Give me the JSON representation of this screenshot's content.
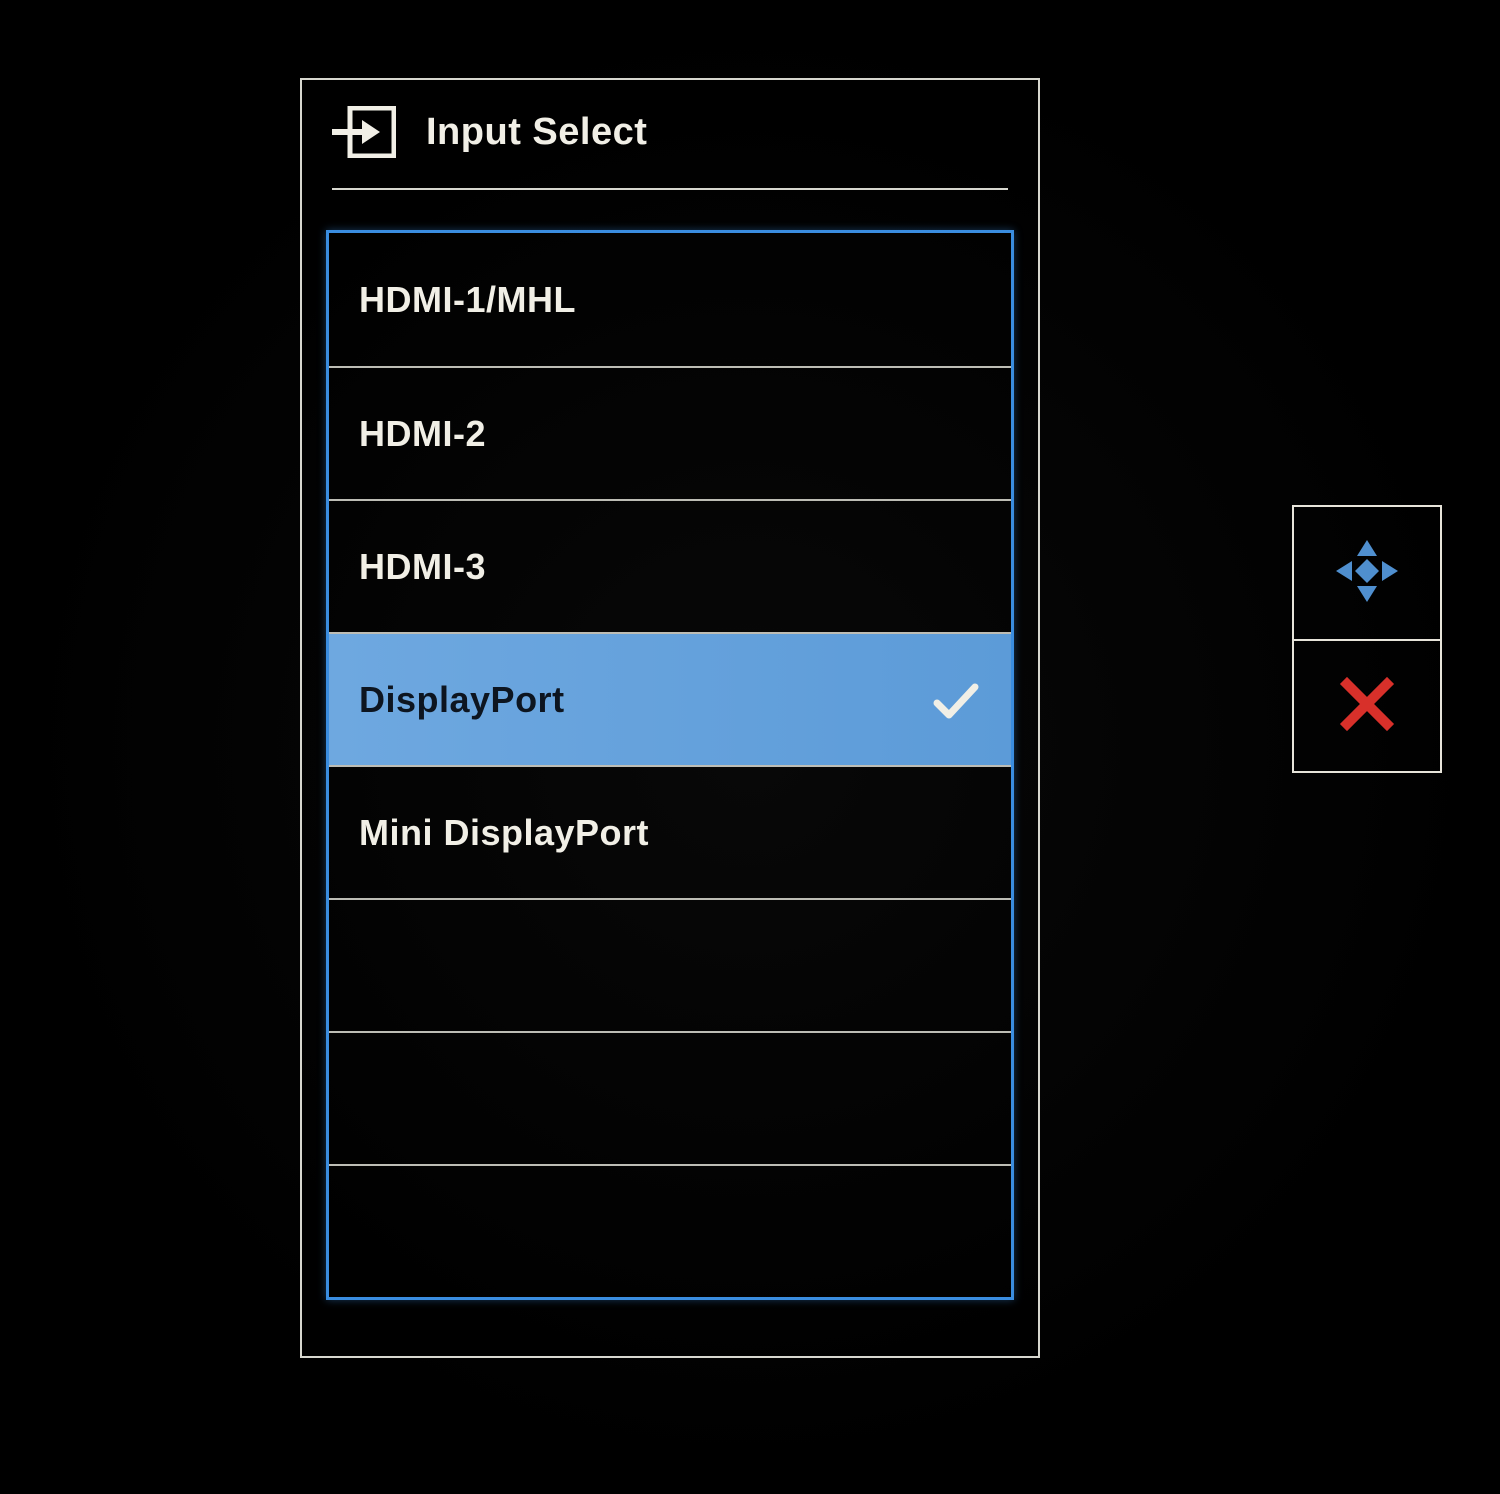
{
  "menu": {
    "title": "Input Select",
    "items": [
      {
        "label": "HDMI-1/MHL",
        "selected": false
      },
      {
        "label": "HDMI-2",
        "selected": false
      },
      {
        "label": "HDMI-3",
        "selected": false
      },
      {
        "label": "DisplayPort",
        "selected": true
      },
      {
        "label": "Mini DisplayPort",
        "selected": false
      },
      {
        "label": "",
        "selected": false
      },
      {
        "label": "",
        "selected": false
      },
      {
        "label": "",
        "selected": false
      }
    ]
  },
  "controls": {
    "navigate_icon": "navigate-joystick-icon",
    "close_icon": "close-x-icon"
  },
  "colors": {
    "highlight": "#6ea8e0",
    "frame_highlight": "#3a8de0",
    "border": "#d7d7cf",
    "close_red": "#d8302a",
    "nav_blue": "#4f8fcf"
  }
}
